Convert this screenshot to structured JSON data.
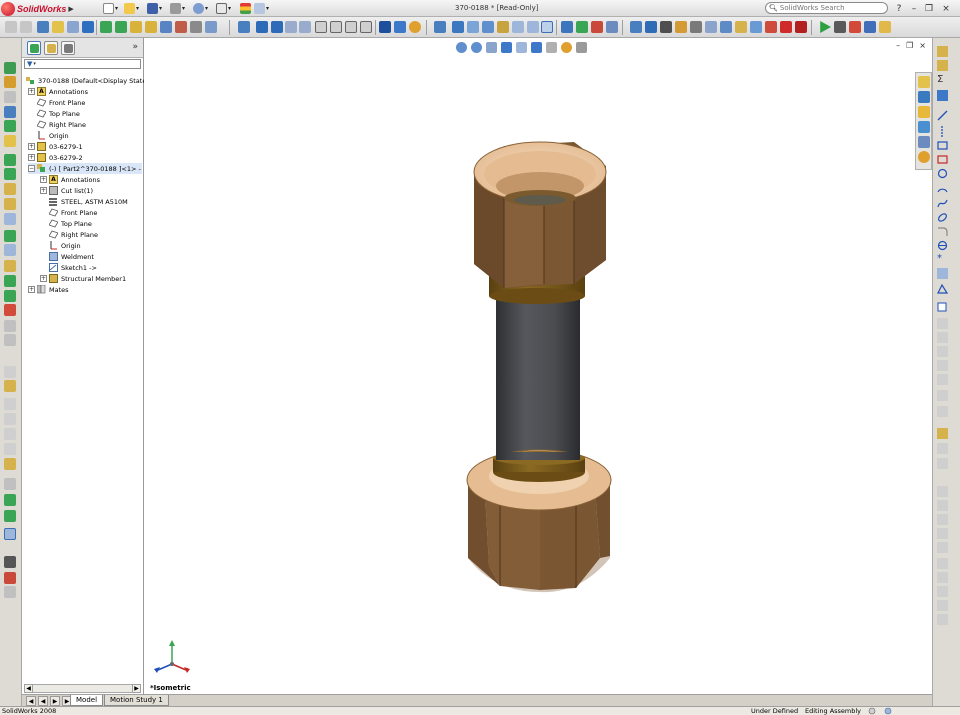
{
  "app": {
    "name": "SolidWorks",
    "document_title": "370-0188 * [Read-Only]",
    "version": "SolidWorks 2008"
  },
  "search": {
    "placeholder": "SolidWorks Search"
  },
  "feature_tree": {
    "root": "370-0188  (Default<Display State",
    "items": [
      {
        "label": "Annotations"
      },
      {
        "label": "Front Plane"
      },
      {
        "label": "Top Plane"
      },
      {
        "label": "Right Plane"
      },
      {
        "label": "Origin"
      },
      {
        "label": "03-6279-1"
      },
      {
        "label": "03-6279-2"
      },
      {
        "label": "(-) [ Part2^370-0188 ]<1> -"
      },
      {
        "label": "Annotations"
      },
      {
        "label": "Cut list(1)"
      },
      {
        "label": "STEEL, ASTM A510M"
      },
      {
        "label": "Front Plane"
      },
      {
        "label": "Top Plane"
      },
      {
        "label": "Right Plane"
      },
      {
        "label": "Origin"
      },
      {
        "label": "Weldment"
      },
      {
        "label": "Sketch1 ->"
      },
      {
        "label": "Structural Member1"
      },
      {
        "label": "Mates"
      }
    ]
  },
  "viewport": {
    "view_name": "*Isometric"
  },
  "tabs": [
    {
      "label": "Model"
    },
    {
      "label": "Motion Study 1"
    }
  ],
  "status": {
    "left": "SolidWorks 2008",
    "under_defined": "Under Defined",
    "editing": "Editing Assembly"
  },
  "icons": {
    "expand_panel": "»",
    "minimize": "–",
    "restore": "❐",
    "close": "×",
    "help": "?",
    "filter": "funnel-icon"
  },
  "colors": {
    "brand": "#c8102e",
    "bronze_light": "#e8c29a",
    "bronze_dark": "#6b4a2c",
    "pipe": "#4a4c50",
    "collar": "#7a5a1a",
    "selection": "#d9e6f7"
  }
}
